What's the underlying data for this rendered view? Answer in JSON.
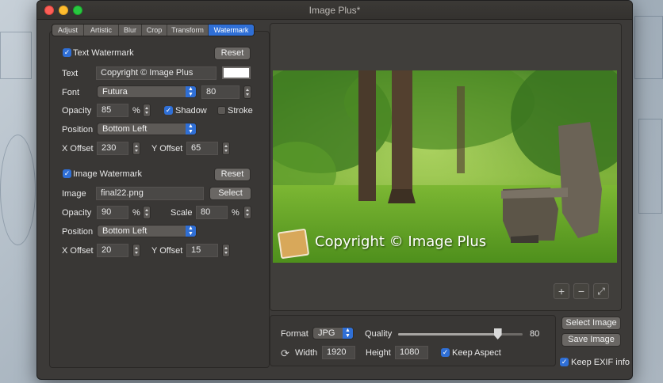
{
  "window": {
    "title": "Image Plus*"
  },
  "tabs": [
    {
      "label": "Adjust",
      "active": false
    },
    {
      "label": "Artistic",
      "active": false
    },
    {
      "label": "Blur",
      "active": false
    },
    {
      "label": "Crop",
      "active": false
    },
    {
      "label": "Transform",
      "active": false
    },
    {
      "label": "Watermark",
      "active": true
    }
  ],
  "text_watermark": {
    "enabled_label": "Text Watermark",
    "enabled": true,
    "reset_label": "Reset",
    "text_label": "Text",
    "text_value": "Copyright © Image Plus",
    "color": "#ffffff",
    "font_label": "Font",
    "font_value": "Futura",
    "font_size": "80",
    "opacity_label": "Opacity",
    "opacity_value": "85",
    "percent": "%",
    "shadow_label": "Shadow",
    "shadow": true,
    "stroke_label": "Stroke",
    "stroke": false,
    "position_label": "Position",
    "position_value": "Bottom Left",
    "x_offset_label": "X Offset",
    "x_offset_value": "230",
    "y_offset_label": "Y Offset",
    "y_offset_value": "65"
  },
  "image_watermark": {
    "enabled_label": "Image Watermark",
    "enabled": true,
    "reset_label": "Reset",
    "image_label": "Image",
    "image_value": "final22.png",
    "select_label": "Select",
    "opacity_label": "Opacity",
    "opacity_value": "90",
    "percent": "%",
    "scale_label": "Scale",
    "scale_value": "80",
    "scale_percent": "%",
    "position_label": "Position",
    "position_value": "Bottom Left",
    "x_offset_label": "X Offset",
    "x_offset_value": "20",
    "y_offset_label": "Y Offset",
    "y_offset_value": "15"
  },
  "preview": {
    "watermark_text": "Copyright © Image Plus",
    "zoom_in": "+",
    "zoom_out": "−",
    "fit": "⤢"
  },
  "export": {
    "format_label": "Format",
    "format_value": "JPG",
    "quality_label": "Quality",
    "quality_value": "80",
    "quality_fraction": 0.8,
    "width_label": "Width",
    "width_value": "1920",
    "height_label": "Height",
    "height_value": "1080",
    "keep_aspect_label": "Keep Aspect",
    "keep_aspect": true,
    "select_image_label": "Select Image",
    "save_image_label": "Save Image",
    "keep_exif_label": "Keep EXIF info",
    "keep_exif": true
  },
  "colors": {
    "accent": "#2f6fd6"
  }
}
